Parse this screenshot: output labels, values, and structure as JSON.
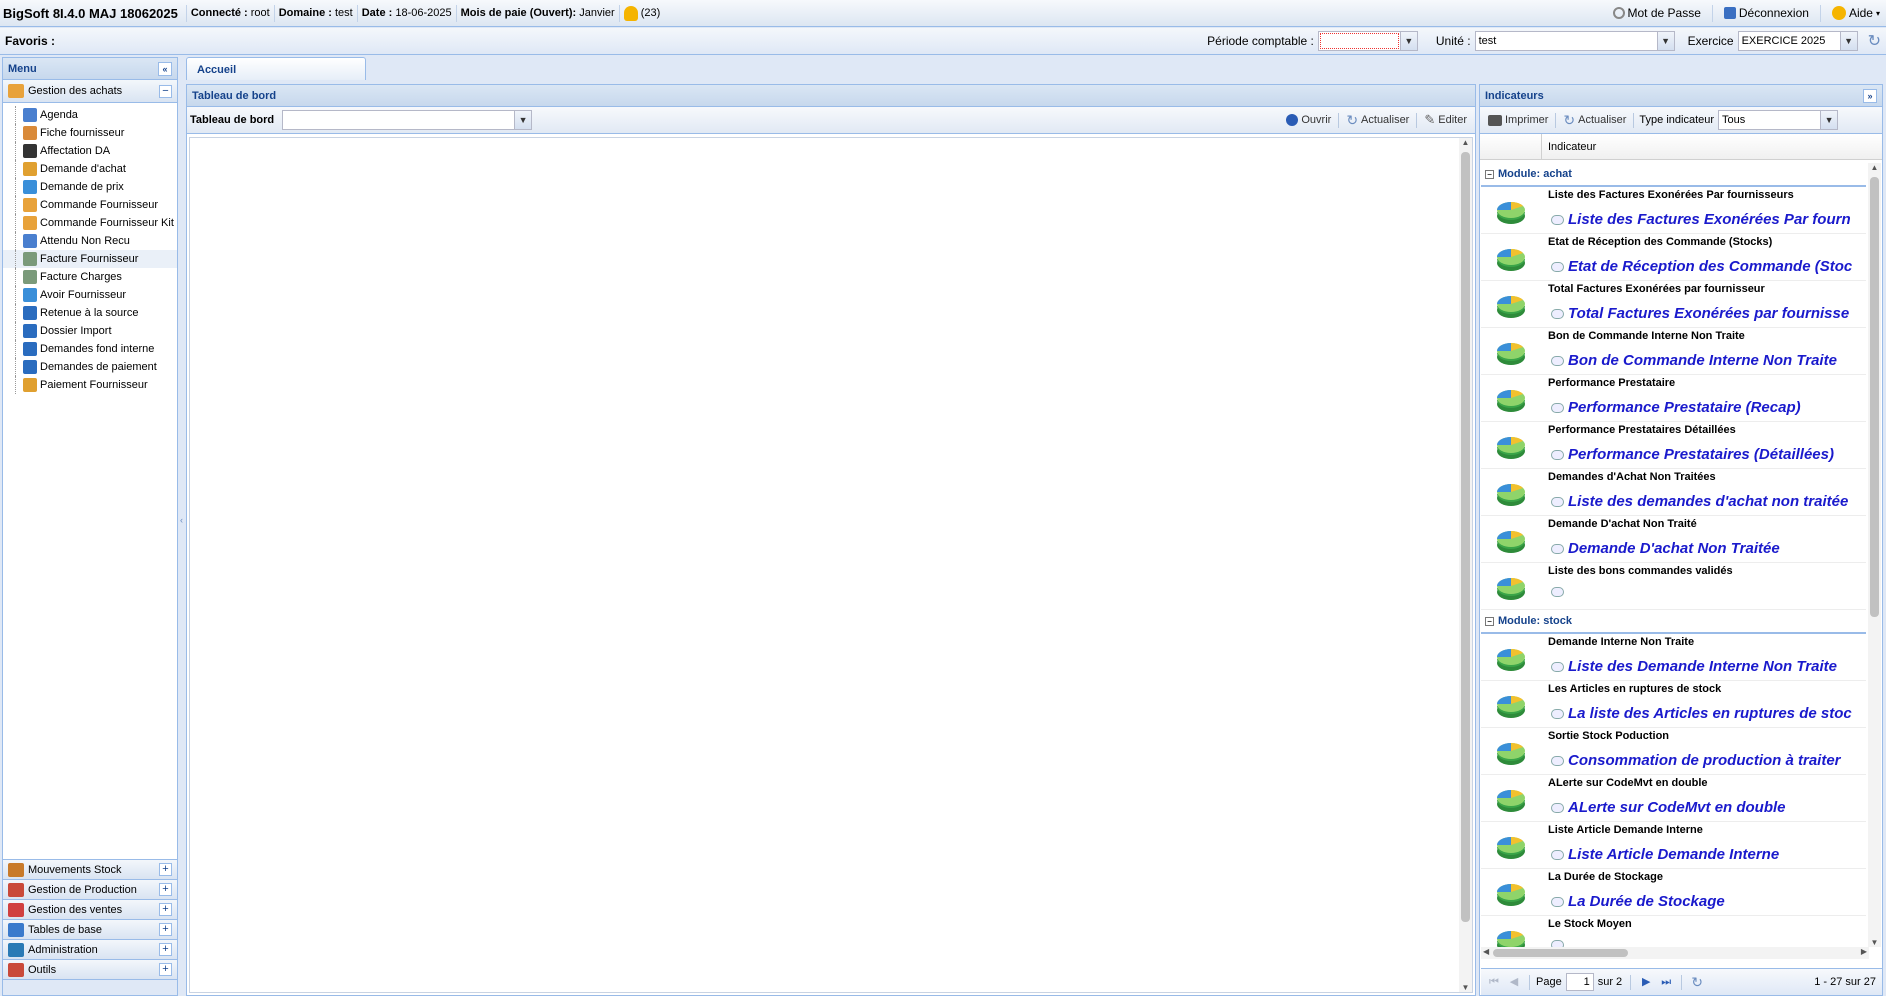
{
  "topbar": {
    "app_title": "BigSoft 8I.4.0 MAJ 18062025",
    "connected_label": "Connecté :",
    "connected_value": "root",
    "domain_label": "Domaine :",
    "domain_value": "test",
    "date_label": "Date :",
    "date_value": "18-06-2025",
    "payroll_label": "Mois de paie (Ouvert):",
    "payroll_value": "Janvier",
    "notifications": "(23)",
    "password": "Mot de Passe",
    "logout": "Déconnexion",
    "help": "Aide"
  },
  "favbar": {
    "favorites": "Favoris :",
    "period_label": "Période comptable :",
    "period_value": "",
    "unit_label": "Unité :",
    "unit_value": "test",
    "exercise_label": "Exercice",
    "exercise_value": "EXERCICE 2025"
  },
  "menu": {
    "title": "Menu",
    "active_section": "Gestion des achats",
    "items": [
      "Agenda",
      "Fiche fournisseur",
      "Affectation DA",
      "Demande d'achat",
      "Demande de prix",
      "Commande Fournisseur",
      "Commande Fournisseur Kit",
      "Attendu Non Recu",
      "Facture Fournisseur",
      "Facture Charges",
      "Avoir Fournisseur",
      "Retenue à la source",
      "Dossier Import",
      "Demandes fond interne",
      "Demandes de paiement",
      "Paiement Fournisseur"
    ],
    "sections": [
      "Mouvements Stock",
      "Gestion de Production",
      "Gestion des ventes",
      "Tables de base",
      "Administration",
      "Outils"
    ]
  },
  "main": {
    "tab": "Accueil",
    "title": "Tableau de bord",
    "dashboard_label": "Tableau de bord",
    "dashboard_value": "",
    "open": "Ouvrir",
    "refresh": "Actualiser",
    "edit": "Editer"
  },
  "indicators": {
    "title": "Indicateurs",
    "print": "Imprimer",
    "refresh": "Actualiser",
    "type_label": "Type indicateur",
    "type_value": "Tous",
    "column": "Indicateur",
    "groups": [
      {
        "name": "Module: achat",
        "rows": [
          {
            "title": "Liste des Factures Exonérées Par fournisseurs",
            "link": "Liste des Factures Exonérées Par fourn"
          },
          {
            "title": "Etat de Réception des Commande (Stocks)",
            "link": "Etat de Réception des Commande (Stoc"
          },
          {
            "title": "Total Factures Exonérées par fournisseur",
            "link": "Total Factures Exonérées par fournisse"
          },
          {
            "title": "Bon de Commande Interne Non Traite",
            "link": "Bon de Commande Interne Non Traite"
          },
          {
            "title": "Performance Prestataire",
            "link": "Performance Prestataire (Recap)"
          },
          {
            "title": "Performance Prestataires Détaillées",
            "link": "Performance Prestataires (Détaillées)"
          },
          {
            "title": "Demandes d'Achat Non Traitées",
            "link": "Liste des demandes d'achat non traitée"
          },
          {
            "title": "Demande D'achat Non Traité",
            "link": "Demande D'achat Non Traitée"
          },
          {
            "title": "Liste des bons commandes validés",
            "link": ""
          }
        ]
      },
      {
        "name": "Module: stock",
        "rows": [
          {
            "title": "Demande Interne Non Traite",
            "link": "Liste des Demande Interne Non Traite"
          },
          {
            "title": "Les Articles en ruptures de stock",
            "link": "La liste des Articles en ruptures de stoc"
          },
          {
            "title": "Sortie Stock Poduction",
            "link": "Consommation de production à traiter"
          },
          {
            "title": "ALerte sur CodeMvt en double",
            "link": "ALerte sur CodeMvt en double"
          },
          {
            "title": "Liste Article Demande Interne",
            "link": "Liste Article Demande Interne"
          },
          {
            "title": "La Durée de Stockage",
            "link": "La Durée de Stockage"
          },
          {
            "title": "Le Stock Moyen",
            "link": ""
          }
        ]
      }
    ],
    "pager": {
      "page_label": "Page",
      "page_value": "1",
      "of": "sur 2",
      "count": "1 - 27 sur 27"
    }
  },
  "colors": {
    "header_blue": "#15428b",
    "link_blue": "#1a1acc",
    "border": "#99bbe8"
  }
}
